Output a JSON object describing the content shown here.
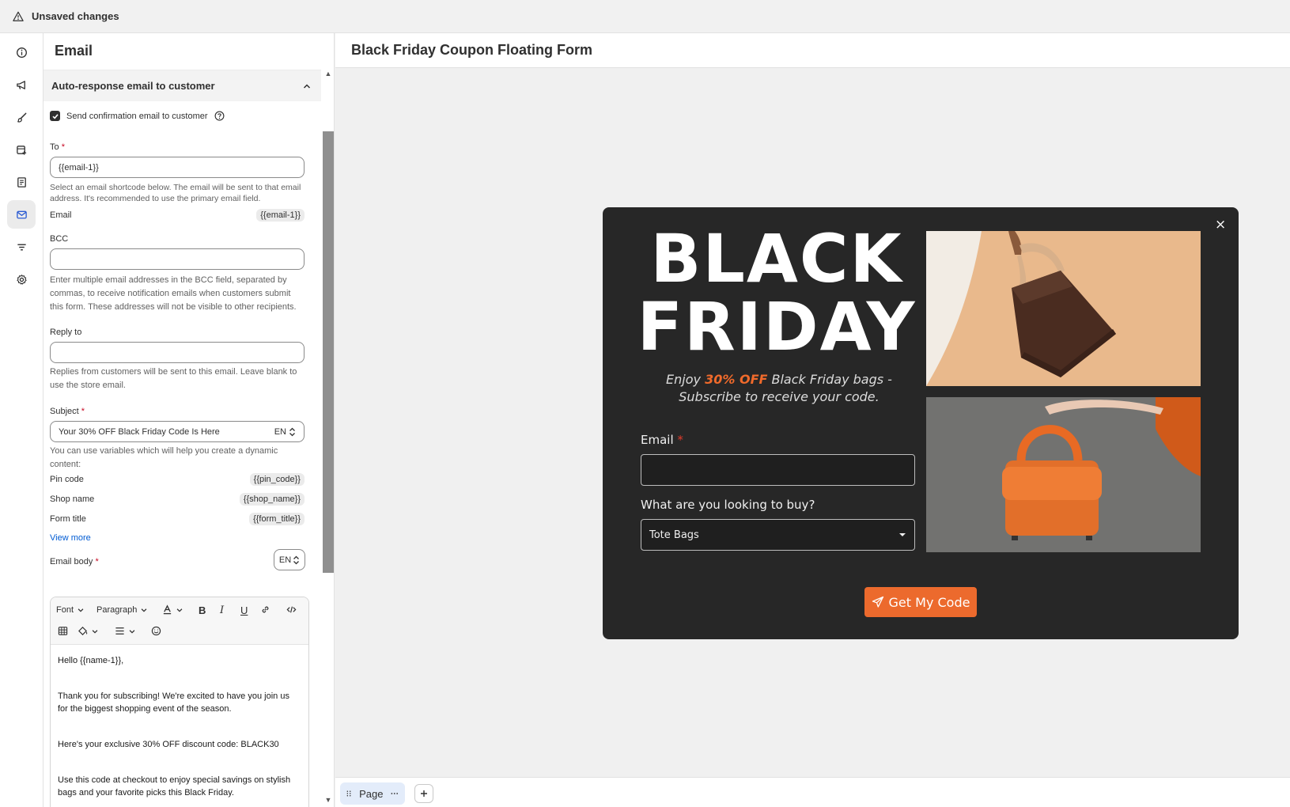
{
  "topbar": {
    "title": "Unsaved changes"
  },
  "panel": {
    "title": "Email",
    "section_title": "Auto-response email to customer",
    "send_confirmation_label": "Send confirmation email to customer",
    "to": {
      "label": "To",
      "required": "*",
      "value": "{{email-1}}",
      "help": "Select an email shortcode below. The email will be sent to that email address. It's recommended to use the primary email field.",
      "shortcode_label": "Email",
      "shortcode": "{{email-1}}"
    },
    "bcc": {
      "label": "BCC",
      "value": "",
      "help": "Enter multiple email addresses in the BCC field, separated by commas, to receive notification emails when customers submit this form. These addresses will not be visible to other recipients."
    },
    "reply_to": {
      "label": "Reply to",
      "value": "",
      "help": "Replies from customers will be sent to this email. Leave blank to use the store email."
    },
    "subject": {
      "label": "Subject",
      "required": "*",
      "value": "Your 30% OFF Black Friday Code Is Here",
      "lang": "EN",
      "help": "You can use variables which will help you create a dynamic content:"
    },
    "variables": [
      {
        "label": "Pin code",
        "code": "{{pin_code}}"
      },
      {
        "label": "Shop name",
        "code": "{{shop_name}}"
      },
      {
        "label": "Form title",
        "code": "{{form_title}}"
      }
    ],
    "view_more": "View more",
    "email_body": {
      "label": "Email body",
      "required": "*",
      "lang": "EN",
      "toolbar": {
        "font": "Font",
        "paragraph": "Paragraph"
      },
      "content": [
        "Hello {{name-1}},",
        "Thank you for subscribing! We're excited to have you join us for the biggest shopping event of the season.",
        "Here's your exclusive 30% OFF discount code: BLACK30",
        "Use this code at checkout to enjoy special savings on stylish bags and your favorite picks this Black Friday."
      ]
    }
  },
  "canvas": {
    "title": "Black Friday Coupon Floating Form",
    "page_tab": "Page"
  },
  "popup": {
    "close": "×",
    "headline_line1": "BLACK",
    "headline_line2": "FRIDAY",
    "sub_prefix": "Enjoy ",
    "sub_highlight": "30% OFF",
    "sub_suffix": " Black Friday bags - Subscribe to receive your code.",
    "email_label": "Email",
    "email_required": "*",
    "question_label": "What are you looking to buy?",
    "select_value": "Tote Bags",
    "cta": "Get My Code"
  },
  "colors": {
    "accent": "#ec6a2d",
    "popup_bg": "#272727",
    "required": "#c70a24"
  }
}
